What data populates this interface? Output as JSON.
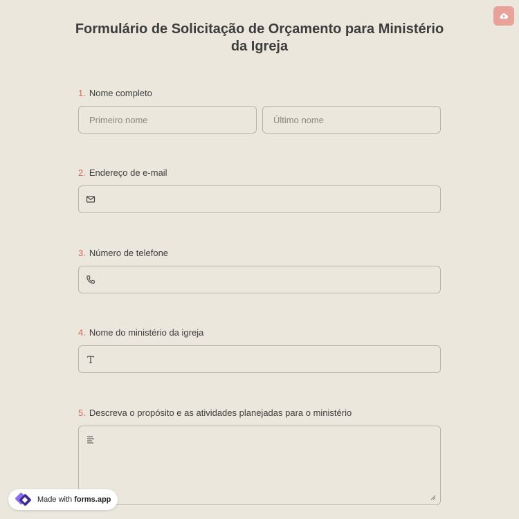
{
  "form": {
    "title": "Formulário de Solicitação de Orçamento para Ministério da Igreja",
    "questions": [
      {
        "num": "1.",
        "label": "Nome completo",
        "first_placeholder": "Primeiro nome",
        "last_placeholder": "Último nome"
      },
      {
        "num": "2.",
        "label": "Endereço de e-mail",
        "icon": "mail-icon"
      },
      {
        "num": "3.",
        "label": "Número de telefone",
        "icon": "phone-icon"
      },
      {
        "num": "4.",
        "label": "Nome do ministério da igreja",
        "icon": "text-icon"
      },
      {
        "num": "5.",
        "label": "Descreva o propósito e as atividades planejadas para o ministério",
        "icon": "paragraph-icon"
      }
    ]
  },
  "badge": {
    "prefix": "Made with",
    "brand": "forms.app"
  },
  "colors": {
    "background": "#ebe7dd",
    "accent": "#d4685a",
    "save_button": "#e8a29a"
  }
}
